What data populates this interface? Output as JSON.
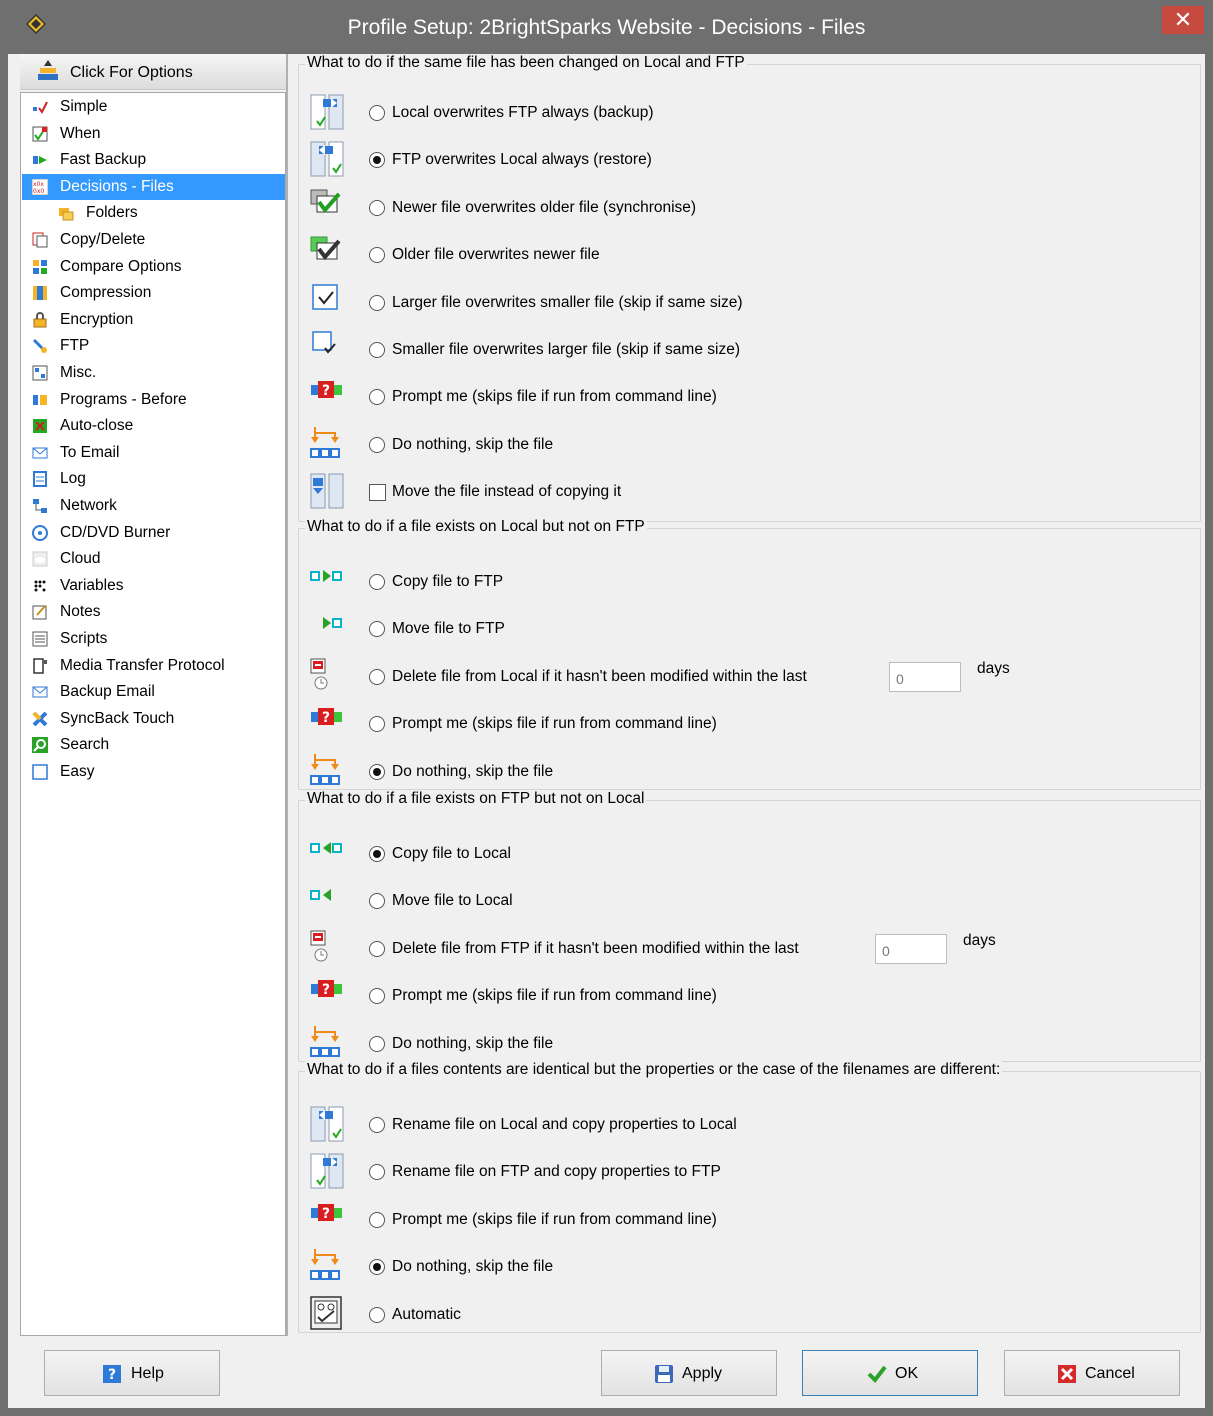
{
  "window": {
    "title": "Profile Setup: 2BrightSparks Website - Decisions - Files",
    "close_glyph": "✕"
  },
  "options_button": {
    "label": "Click For Options"
  },
  "tree": [
    {
      "label": "Simple",
      "icon": "simple-icon",
      "selected": false,
      "indent": 0
    },
    {
      "label": "When",
      "icon": "when-icon",
      "selected": false,
      "indent": 0
    },
    {
      "label": "Fast Backup",
      "icon": "fast-backup-icon",
      "selected": false,
      "indent": 0
    },
    {
      "label": "Decisions - Files",
      "icon": "decisions-icon",
      "selected": true,
      "indent": 0
    },
    {
      "label": "Folders",
      "icon": "folders-icon",
      "selected": false,
      "indent": 1
    },
    {
      "label": "Copy/Delete",
      "icon": "copy-delete-icon",
      "selected": false,
      "indent": 0
    },
    {
      "label": "Compare Options",
      "icon": "compare-icon",
      "selected": false,
      "indent": 0
    },
    {
      "label": "Compression",
      "icon": "compression-icon",
      "selected": false,
      "indent": 0
    },
    {
      "label": "Encryption",
      "icon": "lock-icon",
      "selected": false,
      "indent": 0
    },
    {
      "label": "FTP",
      "icon": "ftp-icon",
      "selected": false,
      "indent": 0
    },
    {
      "label": "Misc.",
      "icon": "misc-icon",
      "selected": false,
      "indent": 0
    },
    {
      "label": "Programs - Before",
      "icon": "programs-icon",
      "selected": false,
      "indent": 0
    },
    {
      "label": "Auto-close",
      "icon": "auto-close-icon",
      "selected": false,
      "indent": 0
    },
    {
      "label": "To Email",
      "icon": "email-icon",
      "selected": false,
      "indent": 0
    },
    {
      "label": "Log",
      "icon": "log-icon",
      "selected": false,
      "indent": 0
    },
    {
      "label": "Network",
      "icon": "network-icon",
      "selected": false,
      "indent": 0
    },
    {
      "label": "CD/DVD Burner",
      "icon": "disc-icon",
      "selected": false,
      "indent": 0
    },
    {
      "label": "Cloud",
      "icon": "cloud-icon",
      "selected": false,
      "indent": 0
    },
    {
      "label": "Variables",
      "icon": "variables-icon",
      "selected": false,
      "indent": 0
    },
    {
      "label": "Notes",
      "icon": "notes-icon",
      "selected": false,
      "indent": 0
    },
    {
      "label": "Scripts",
      "icon": "scripts-icon",
      "selected": false,
      "indent": 0
    },
    {
      "label": "Media Transfer Protocol",
      "icon": "mtp-icon",
      "selected": false,
      "indent": 0
    },
    {
      "label": "Backup Email",
      "icon": "backup-email-icon",
      "selected": false,
      "indent": 0
    },
    {
      "label": "SyncBack Touch",
      "icon": "syncback-touch-icon",
      "selected": false,
      "indent": 0
    },
    {
      "label": "Search",
      "icon": "search-icon",
      "selected": false,
      "indent": 0
    },
    {
      "label": "Easy",
      "icon": "easy-icon",
      "selected": false,
      "indent": 0
    }
  ],
  "groups": {
    "both_changed": {
      "title": "What to do if the same file has been changed on Local and FTP",
      "options": [
        {
          "label": "Local overwrites FTP always (backup)",
          "type": "radio",
          "checked": false,
          "icon": "local-to-ftp-icon"
        },
        {
          "label": "FTP overwrites Local always (restore)",
          "type": "radio",
          "checked": true,
          "icon": "ftp-to-local-icon"
        },
        {
          "label": "Newer file overwrites older file (synchronise)",
          "type": "radio",
          "checked": false,
          "icon": "newer-check-icon"
        },
        {
          "label": "Older file overwrites newer file",
          "type": "radio",
          "checked": false,
          "icon": "older-check-icon"
        },
        {
          "label": "Larger file overwrites smaller file (skip if same size)",
          "type": "radio",
          "checked": false,
          "icon": "larger-check-icon"
        },
        {
          "label": "Smaller file overwrites larger file (skip if same size)",
          "type": "radio",
          "checked": false,
          "icon": "smaller-check-icon"
        },
        {
          "label": "Prompt me (skips file if run from command line)",
          "type": "radio",
          "checked": false,
          "icon": "prompt-icon"
        },
        {
          "label": "Do nothing, skip the file",
          "type": "radio",
          "checked": false,
          "icon": "skip-icon"
        },
        {
          "label": "Move the file instead of copying it",
          "type": "checkbox",
          "checked": false,
          "icon": "move-icon"
        }
      ]
    },
    "local_only": {
      "title": "What to do if a file exists on Local but not on FTP",
      "options": [
        {
          "label": "Copy file to FTP",
          "type": "radio",
          "checked": false,
          "icon": "copy-right-icon"
        },
        {
          "label": "Move file to FTP",
          "type": "radio",
          "checked": false,
          "icon": "move-right-icon"
        },
        {
          "label": "Delete file from Local if it hasn't been modified within the last",
          "type": "radio",
          "checked": false,
          "icon": "delete-timer-icon",
          "days_value": "0",
          "days_label": "days"
        },
        {
          "label": "Prompt me  (skips file if run from command line)",
          "type": "radio",
          "checked": false,
          "icon": "prompt-icon"
        },
        {
          "label": "Do nothing, skip the file",
          "type": "radio",
          "checked": true,
          "icon": "skip-icon"
        }
      ]
    },
    "ftp_only": {
      "title": "What to do if a file exists on FTP but not on Local",
      "options": [
        {
          "label": "Copy file to Local",
          "type": "radio",
          "checked": true,
          "icon": "copy-left-icon"
        },
        {
          "label": "Move file to Local",
          "type": "radio",
          "checked": false,
          "icon": "move-left-icon"
        },
        {
          "label": "Delete file from FTP if it hasn't been modified within the last",
          "type": "radio",
          "checked": false,
          "icon": "delete-timer-icon",
          "days_value": "0",
          "days_label": "days"
        },
        {
          "label": "Prompt me  (skips file if run from command line)",
          "type": "radio",
          "checked": false,
          "icon": "prompt-icon"
        },
        {
          "label": "Do nothing, skip the file",
          "type": "radio",
          "checked": false,
          "icon": "skip-icon"
        }
      ]
    },
    "identical_props": {
      "title": "What to do if a files contents are identical but the properties or the case of the filenames are different:",
      "options": [
        {
          "label": "Rename file on Local and copy properties to Local",
          "type": "radio",
          "checked": false,
          "icon": "ftp-to-local-icon"
        },
        {
          "label": "Rename file on FTP and copy properties to FTP",
          "type": "radio",
          "checked": false,
          "icon": "local-to-ftp-icon"
        },
        {
          "label": "Prompt me  (skips file if run from command line)",
          "type": "radio",
          "checked": false,
          "icon": "prompt-icon"
        },
        {
          "label": "Do nothing, skip the file",
          "type": "radio",
          "checked": true,
          "icon": "skip-icon"
        },
        {
          "label": "Automatic",
          "type": "radio",
          "checked": false,
          "icon": "automatic-icon"
        }
      ]
    }
  },
  "buttons": {
    "help": "Help",
    "apply": "Apply",
    "ok": "OK",
    "cancel": "Cancel"
  },
  "colors": {
    "selection": "#3399ff",
    "titlebar": "#6f6f6f",
    "close": "#c74a3e"
  }
}
